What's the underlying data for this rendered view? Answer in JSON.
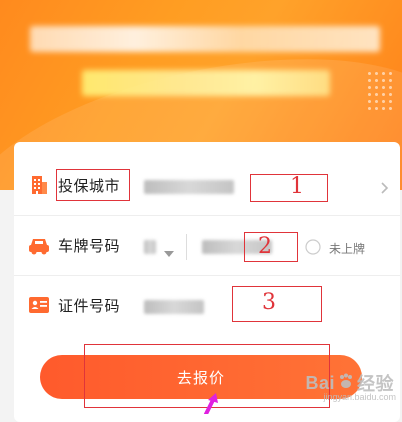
{
  "form": {
    "city_label": "投保城市",
    "plate_label": "车牌号码",
    "plate_unregistered_label": "未上牌",
    "id_label": "证件号码",
    "submit_label": "去报价"
  },
  "annotations": [
    "1",
    "2",
    "3"
  ],
  "watermark": {
    "brand": "Bai",
    "brand2": "经验",
    "url": "jingyan.baidu.com"
  },
  "colors": {
    "banner": "#ff9a22",
    "accent": "#ff6a30",
    "annotation": "#e0343a"
  },
  "icons": [
    "building-icon",
    "car-icon",
    "id-card-icon",
    "chevron-right-icon",
    "caret-down-icon",
    "radio-icon",
    "pointer-arrow-icon"
  ]
}
